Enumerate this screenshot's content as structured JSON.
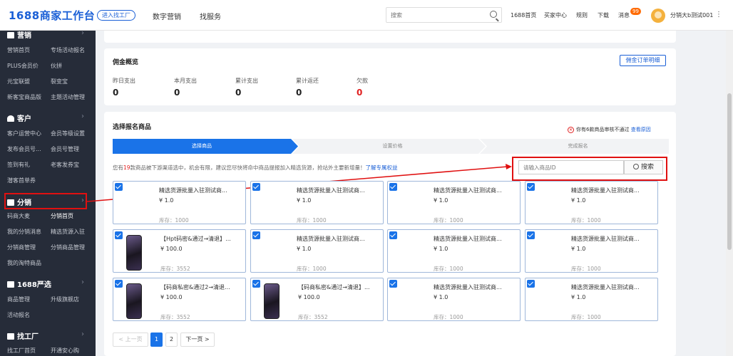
{
  "topbar": {
    "logo": "1688商家工作台",
    "enter_factory": "进入找工厂",
    "nav": [
      "数字营销",
      "找服务"
    ],
    "search_placeholder": "搜索",
    "links": [
      "1688首页",
      "买家中心",
      "规则",
      "下载",
      "消息"
    ],
    "msg_count": "99",
    "username": "分销大b测试001",
    "more": "⋮"
  },
  "sidebar": {
    "marketing": {
      "title": "营销",
      "items": [
        "营销首页",
        "专场活动报名",
        "PLUS会员价",
        "伙拼",
        "元宝联盟",
        "裂变宝",
        "新客宝商品版",
        "主题活动管理"
      ]
    },
    "customer": {
      "title": "客户",
      "items": [
        "客户运营中心",
        "会员等级设置",
        "发布会员号...",
        "会员号管理",
        "签到有礼",
        "老客发券宝",
        "潜客首单券"
      ]
    },
    "distribution": {
      "title": "分销",
      "items": [
        "码商大麦",
        "分销首页",
        "我的分销消息",
        "精选货源入驻",
        "分销商管理",
        "分销商品管理",
        "我的淘特商品"
      ]
    },
    "yanxuan": {
      "title": "1688严选",
      "items": [
        "商品管理",
        "升级旗舰店",
        "活动报名"
      ]
    },
    "factory": {
      "title": "找工厂",
      "items": [
        "找工厂首页",
        "开通安心购"
      ]
    }
  },
  "commission": {
    "title": "佣金概览",
    "detail_btn": "佣金订单明细",
    "stats": [
      {
        "label": "昨日支出",
        "value": "0"
      },
      {
        "label": "本月支出",
        "value": "0"
      },
      {
        "label": "累计支出",
        "value": "0"
      },
      {
        "label": "累计返还",
        "value": "0"
      },
      {
        "label": "欠款",
        "value": "0"
      }
    ]
  },
  "select": {
    "title": "选择报名商品",
    "warning_text": "你有6款商品审核不通过",
    "warning_link": "查看原因",
    "steps": [
      "选择商品",
      "设置价格",
      "完成报名"
    ],
    "hint_prefix": "您有",
    "hint_count": "19",
    "hint_text": "款商品被下游渠道选中，机会有限，建议您尽快将命中商品提报加入精选货源，抢站外主要新增量！",
    "hint_link": "了解专属权益",
    "search_placeholder": "请输入商品ID",
    "search_btn": "搜索"
  },
  "products": [
    {
      "title": "精选货源批量入驻测试商...",
      "price": "¥ 1.0",
      "stock": "库存：1000",
      "img": false
    },
    {
      "title": "精选货源批量入驻测试商...",
      "price": "¥ 1.0",
      "stock": "库存：1000",
      "img": false
    },
    {
      "title": "精选货源批量入驻测试商...",
      "price": "¥ 1.0",
      "stock": "库存：1000",
      "img": false
    },
    {
      "title": "精选货源批量入驻测试商...",
      "price": "¥ 1.0",
      "stock": "库存：1000",
      "img": false
    },
    {
      "title": "【Hpt码密&通过→清退】...",
      "price": "¥ 100.0",
      "stock": "库存：3552",
      "img": true
    },
    {
      "title": "精选货源批量入驻测试商...",
      "price": "¥ 1.0",
      "stock": "库存：1000",
      "img": false
    },
    {
      "title": "精选货源批量入驻测试商...",
      "price": "¥ 1.0",
      "stock": "库存：1000",
      "img": false
    },
    {
      "title": "精选货源批量入驻测试商...",
      "price": "¥ 1.0",
      "stock": "库存：1000",
      "img": false
    },
    {
      "title": "【码商私密&通过2→清退...",
      "price": "¥ 100.0",
      "stock": "库存：3552",
      "img": true
    },
    {
      "title": "【码商私密&通过→清退】...",
      "price": "¥ 100.0",
      "stock": "库存：3552",
      "img": true
    },
    {
      "title": "精选货源批量入驻测试商...",
      "price": "¥ 1.0",
      "stock": "库存：1000",
      "img": false
    },
    {
      "title": "精选货源批量入驻测试商...",
      "price": "¥ 1.0",
      "stock": "库存：1000",
      "img": false
    }
  ],
  "pagination": {
    "prev": "< 上一页",
    "pages": [
      "1",
      "2"
    ],
    "next": "下一页 >"
  },
  "colors": {
    "brand": "#1a5fd6",
    "sidebar_bg": "#262c39",
    "highlight": "#e01010",
    "orange": "#ff6a00"
  }
}
